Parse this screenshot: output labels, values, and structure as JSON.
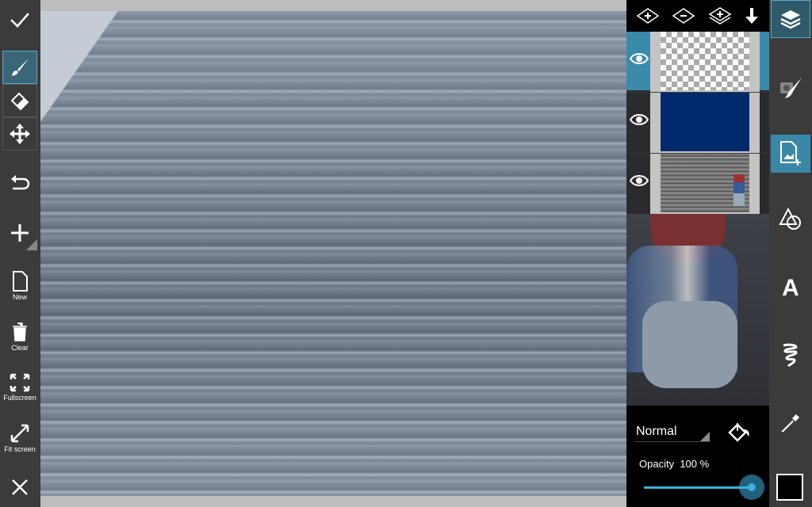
{
  "left_toolbar": {
    "confirm_icon": "checkmark-icon",
    "tools": [
      "brush",
      "eraser",
      "move"
    ],
    "active_tool": "brush",
    "new_label": "New",
    "clear_label": "Clear",
    "fullscreen_label": "Fullscreen",
    "fit_screen_label": "Fit screen"
  },
  "layers_panel": {
    "header_actions": [
      "add-layer",
      "remove-layer",
      "duplicate-layer",
      "merge-down"
    ],
    "layers": [
      {
        "type": "transparent",
        "visible": true,
        "selected": true
      },
      {
        "type": "solid",
        "color": "#002a6c",
        "visible": true,
        "selected": false
      },
      {
        "type": "photo",
        "visible": true,
        "selected": false
      }
    ],
    "blend_mode": "Normal",
    "opacity_label": "Opacity",
    "opacity_value": "100 %",
    "opacity": 100
  },
  "right_toolbar": {
    "items": [
      "layers",
      "photo-brush",
      "add-photo",
      "shapes",
      "text",
      "effects-brush",
      "color-picker",
      "color-swatch"
    ],
    "text_tool_label": "A",
    "accent_color": "#3a88a8",
    "current_color": "#000000"
  }
}
